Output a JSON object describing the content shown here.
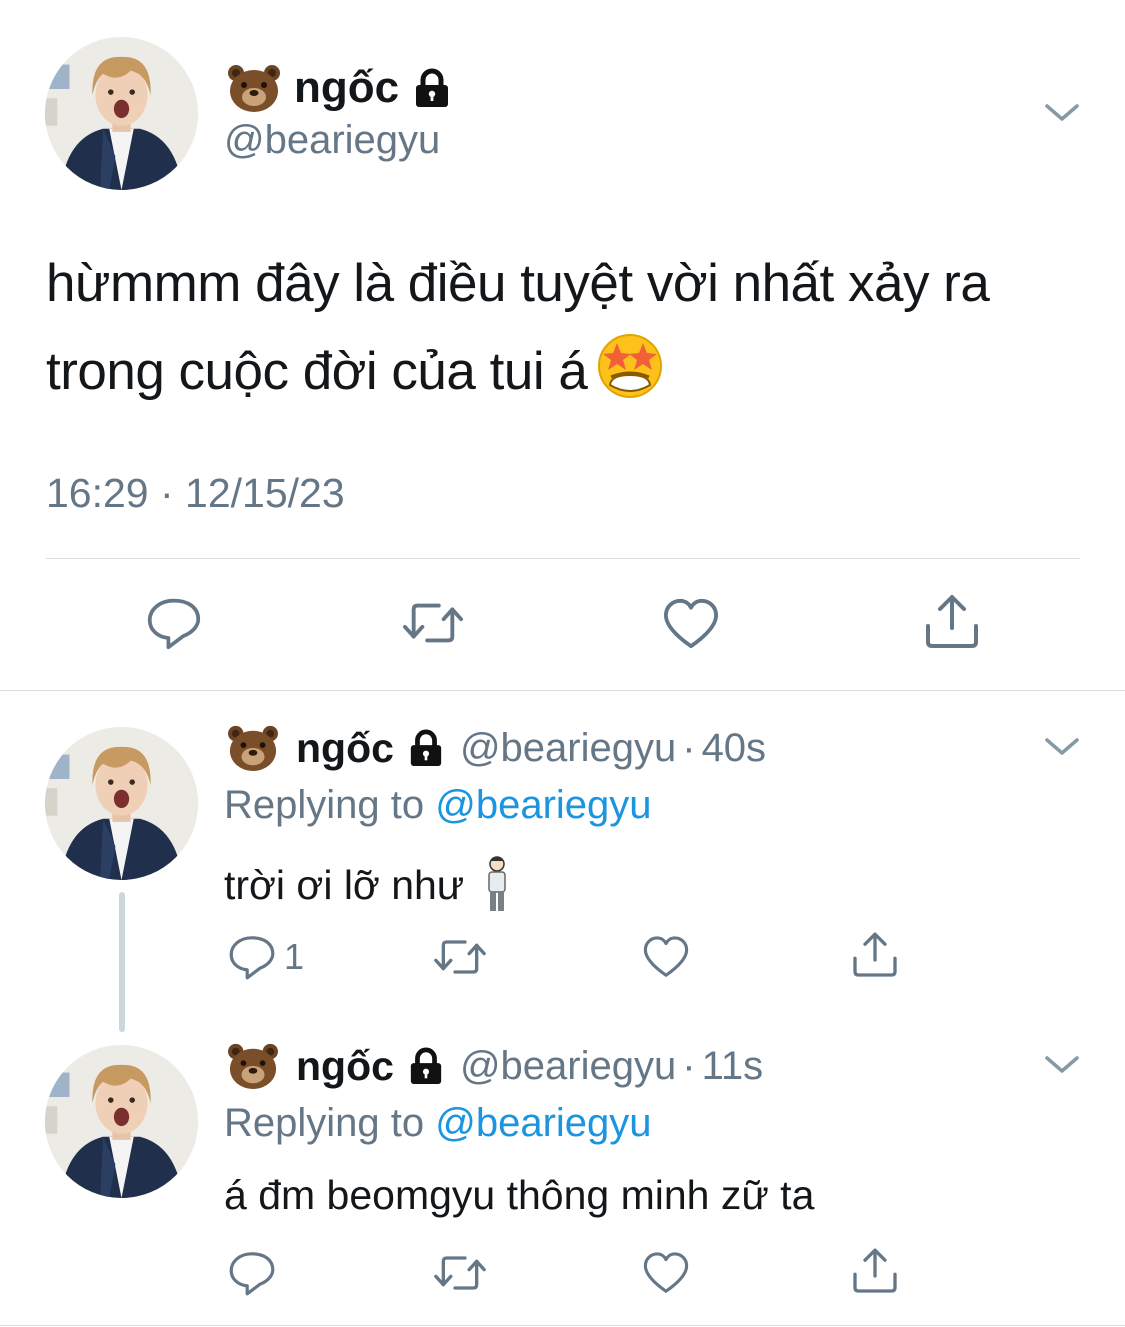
{
  "tweet": {
    "display_name": "ngốc",
    "handle": "@beariegyu",
    "text": "hừmmm đây là điều tuyệt vời nhất xảy ra trong cuộc đời của tui á",
    "timestamp": "16:29 · 12/15/23",
    "icons": [
      "bear-emoji",
      "lock-icon",
      "chevron-down-icon",
      "star-struck-emoji",
      "reply-icon",
      "retweet-icon",
      "like-icon",
      "share-icon"
    ]
  },
  "replies": [
    {
      "display_name": "ngốc",
      "handle": "@beariegyu",
      "separator": "·",
      "time_ago": "40s",
      "replying_prefix": "Replying to",
      "replying_handle": "@beariegyu",
      "text": "trời ơi lỡ như",
      "reply_count": "1"
    },
    {
      "display_name": "ngốc",
      "handle": "@beariegyu",
      "separator": "·",
      "time_ago": "11s",
      "replying_prefix": "Replying to",
      "replying_handle": "@beariegyu",
      "text": "á đm beomgyu thông minh zữ ta",
      "reply_count": ""
    }
  ],
  "colors": {
    "text": "#14171a",
    "secondary": "#657786",
    "link": "#1b95e0",
    "divider": "#d9dfe3",
    "icon": "#657786"
  }
}
